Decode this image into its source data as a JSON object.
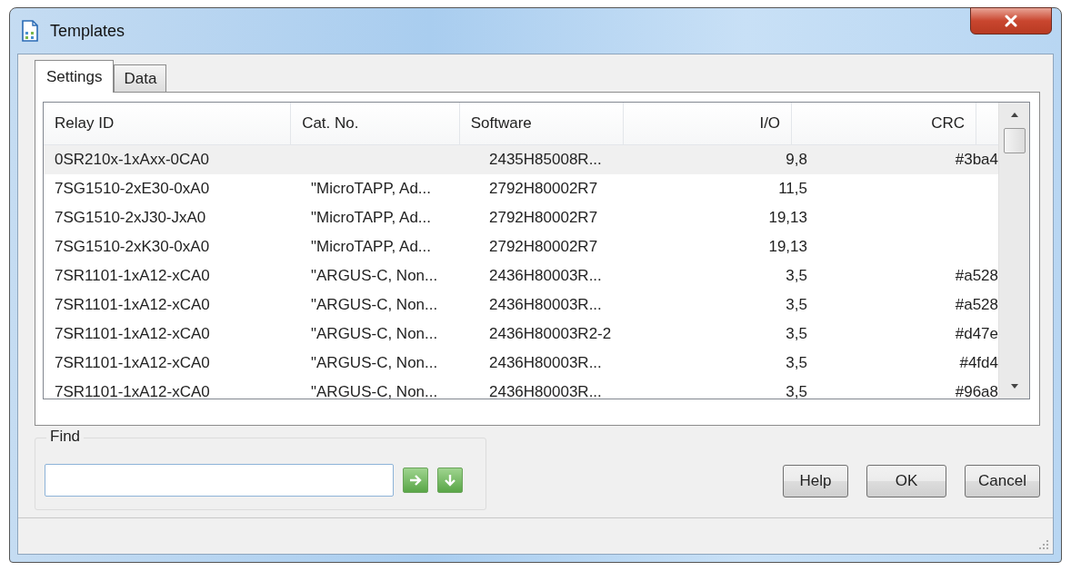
{
  "window": {
    "title": "Templates"
  },
  "tabs": [
    {
      "label": "Settings",
      "selected": true
    },
    {
      "label": "Data",
      "selected": false
    }
  ],
  "table": {
    "columns": [
      "Relay ID",
      "Cat. No.",
      "Software",
      "I/O",
      "CRC"
    ],
    "rows": [
      {
        "selected": true,
        "cells": [
          "0SR210x-1xAxx-0CA0",
          "",
          "2435H85008R...",
          "9,8",
          "#3ba4"
        ]
      },
      {
        "selected": false,
        "cells": [
          "7SG1510-2xE30-0xA0",
          "\"MicroTAPP, Ad...",
          "2792H80002R7",
          "11,5",
          ""
        ]
      },
      {
        "selected": false,
        "cells": [
          "7SG1510-2xJ30-JxA0",
          "\"MicroTAPP, Ad...",
          "2792H80002R7",
          "19,13",
          ""
        ]
      },
      {
        "selected": false,
        "cells": [
          "7SG1510-2xK30-0xA0",
          "\"MicroTAPP, Ad...",
          "2792H80002R7",
          "19,13",
          ""
        ]
      },
      {
        "selected": false,
        "cells": [
          "7SR1101-1xA12-xCA0",
          "\"ARGUS-C, Non...",
          "2436H80003R...",
          "3,5",
          "#a528"
        ]
      },
      {
        "selected": false,
        "cells": [
          "7SR1101-1xA12-xCA0",
          "\"ARGUS-C, Non...",
          "2436H80003R...",
          "3,5",
          "#a528"
        ]
      },
      {
        "selected": false,
        "cells": [
          "7SR1101-1xA12-xCA0",
          "\"ARGUS-C, Non...",
          "2436H80003R2-2",
          "3,5",
          "#d47e"
        ]
      },
      {
        "selected": false,
        "cells": [
          "7SR1101-1xA12-xCA0",
          "\"ARGUS-C, Non...",
          "2436H80003R...",
          "3,5",
          "#4fd4"
        ]
      },
      {
        "selected": false,
        "cells": [
          "7SR1101-1xA12-xCA0",
          "\"ARGUS-C, Non...",
          "2436H80003R...",
          "3,5",
          "#96a8"
        ]
      }
    ]
  },
  "find": {
    "label": "Find"
  },
  "buttons": [
    "Help",
    "OK",
    "Cancel"
  ]
}
